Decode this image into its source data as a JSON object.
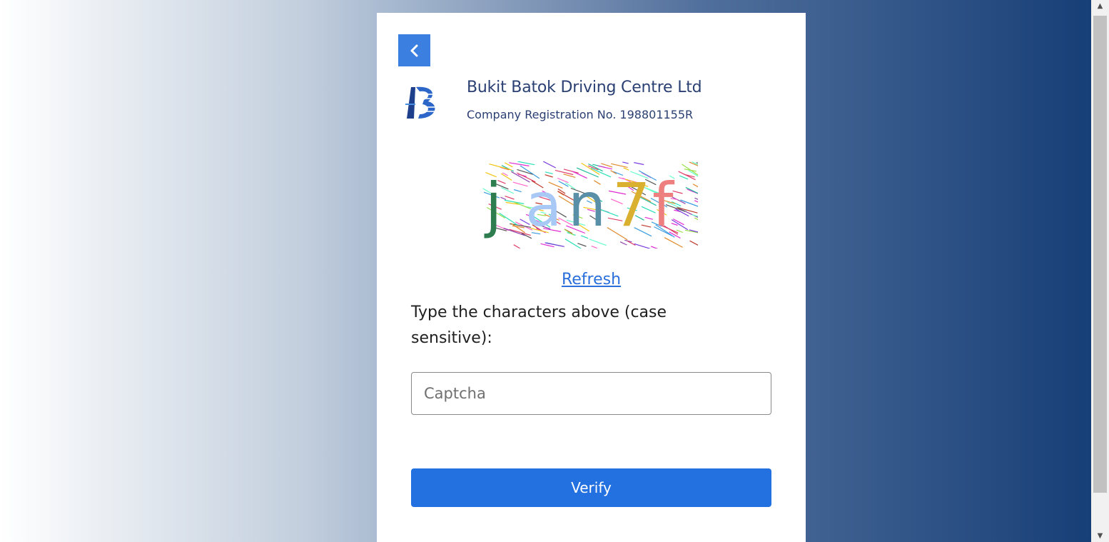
{
  "company": {
    "name": "Bukit Batok Driving Centre Ltd",
    "registration": "Company Registration No. 198801155R"
  },
  "captcha": {
    "characters": [
      "j",
      "a",
      "n",
      "7",
      "f"
    ],
    "character_colors": [
      "#2e7d4f",
      "#a8c8f5",
      "#5a8fa8",
      "#d9b030",
      "#ee7f7f"
    ],
    "refresh_label": "Refresh",
    "instructions": "Type the characters above (case sensitive):",
    "input_placeholder": "Captcha",
    "input_value": ""
  },
  "actions": {
    "verify_label": "Verify"
  },
  "icons": {
    "back": "chevron-left-icon",
    "logo": "company-logo",
    "scroll_up": "triangle-up-icon",
    "scroll_down": "triangle-down-icon"
  },
  "colors": {
    "accent": "#2370e0",
    "back_button": "#3b7fe0",
    "link": "#2a6fdb",
    "brand_text": "#2a3f72"
  }
}
